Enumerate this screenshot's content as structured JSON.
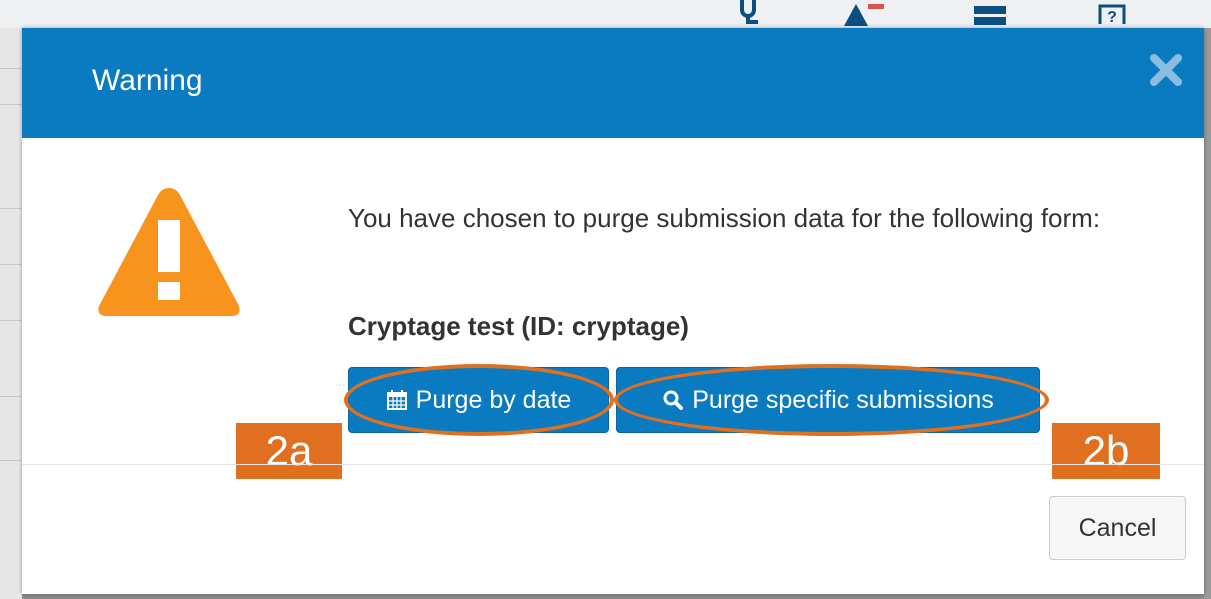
{
  "modal": {
    "title": "Warning",
    "message": "You have chosen to purge submission data for the following form:",
    "form_name": "Cryptage test (ID: cryptage)",
    "buttons": {
      "purge_by_date": "Purge by date",
      "purge_specific": "Purge specific submissions",
      "cancel": "Cancel"
    },
    "icons": {
      "close": "close-icon",
      "warning": "warning-triangle-icon",
      "calendar": "calendar-icon",
      "search": "search-icon"
    }
  },
  "annotations": {
    "tag_a": "2a",
    "tag_b": "2b",
    "color": "#e0701f"
  },
  "background_toolbar": {
    "icons": [
      "stethoscope-icon",
      "alert-icon",
      "server-icon",
      "help-icon"
    ]
  },
  "colors": {
    "header": "#0b7bc1",
    "warning": "#f7941d"
  }
}
